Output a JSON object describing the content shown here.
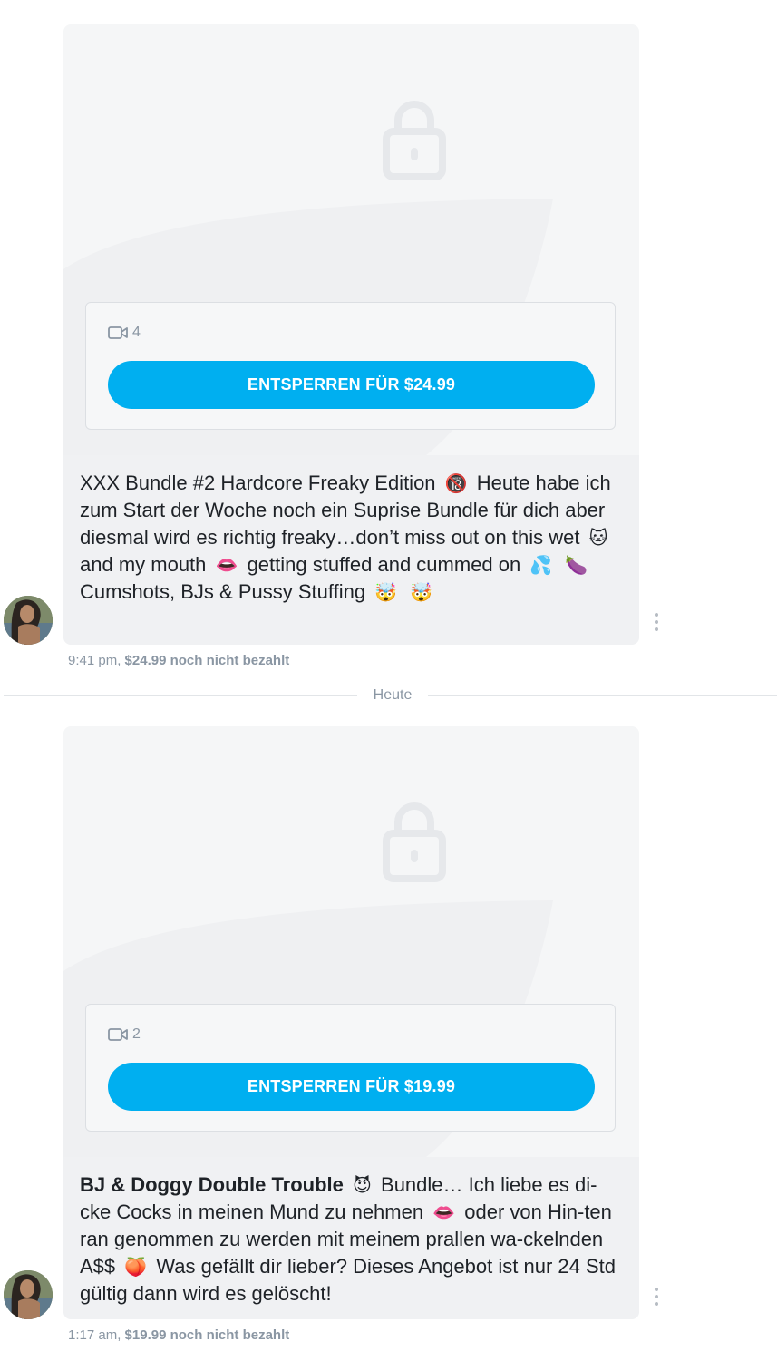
{
  "messages": [
    {
      "video_count": "4",
      "unlock_label": "ENTSPERREN FÜR $24.99",
      "text_segments": [
        "XXX Bundle #2 Hardcore Freaky Edition",
        "Heute habe ich zum Start der Woche noch ein Suprise Bundle für dich aber diesmal wird es richtig freaky…don’t miss out on this wet",
        "and my mouth",
        "getting stuffed and cummed on",
        "Cumshots, BJs & Pussy Stuffing"
      ],
      "emojis": [
        "🔞",
        "🐱",
        "👄",
        "💦",
        "🍆",
        "🤯",
        "🤯"
      ],
      "time": "9:41 pm,",
      "price_status": "$24.99 noch nicht bezahlt"
    },
    {
      "video_count": "2",
      "unlock_label": "ENTSPERREN FÜR $19.99",
      "text_bold": "BJ & Doggy Double Trouble",
      "text_segments": [
        "Bundle… Ich liebe es di-cke Cocks in meinen Mund zu nehmen",
        "oder von Hin-ten ran genommen zu werden mit meinem prallen wa-ckelnden A$$",
        "Was gefällt dir lieber? Dieses Angebot ist nur 24 Std gültig dann wird es gelöscht!"
      ],
      "emojis": [
        "😈",
        "👄",
        "🍑"
      ],
      "time": "1:17 am,",
      "price_status": "$19.99 noch nicht bezahlt"
    }
  ],
  "divider_label": "Heute",
  "colors": {
    "accent": "#00aff0",
    "bubble": "#f0f1f3",
    "media_bg": "#f5f6f7",
    "muted": "#8a96a3"
  },
  "icons": [
    "lock-icon",
    "video-camera-icon",
    "more-options-icon",
    "avatar"
  ]
}
